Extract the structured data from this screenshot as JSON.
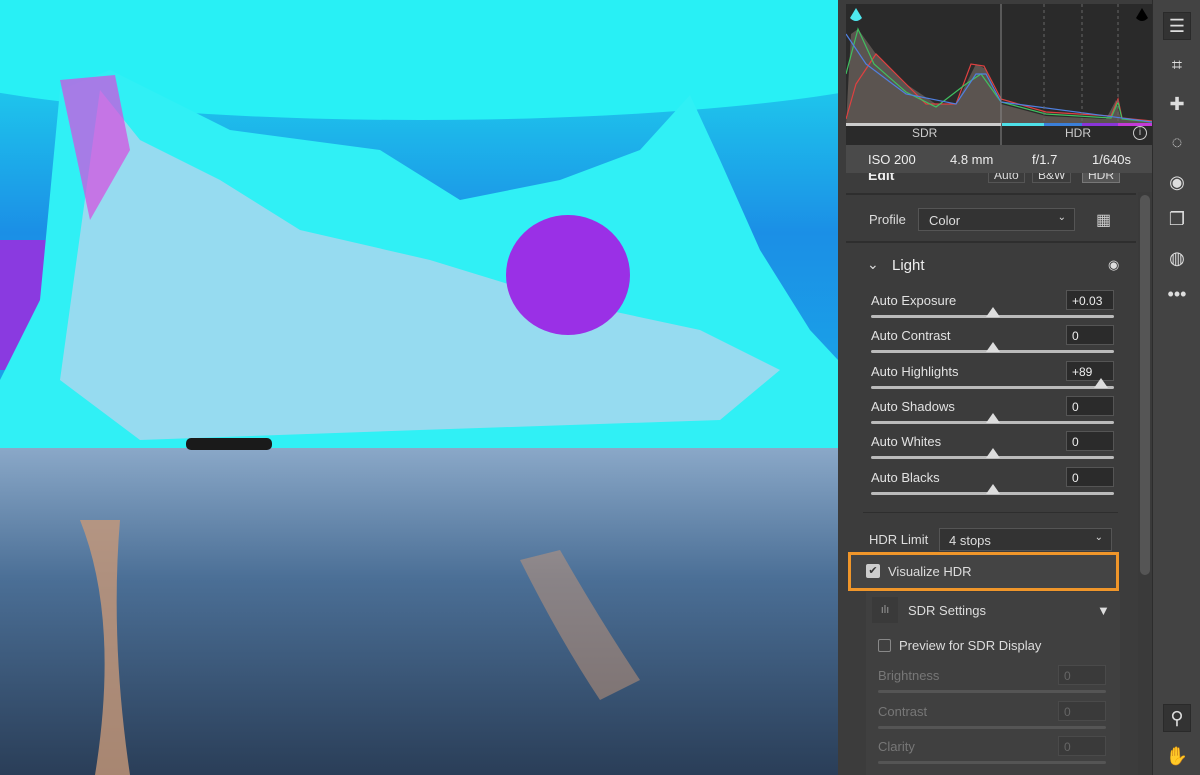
{
  "histogram": {
    "sdr_label": "SDR",
    "hdr_label": "HDR",
    "hdr_colors": [
      "#4ee0e8",
      "#3b7fd8",
      "#8a35d8",
      "#c33ad8"
    ]
  },
  "exif": {
    "iso": "ISO 200",
    "focal": "4.8 mm",
    "aperture": "f/1.7",
    "shutter": "1/640s"
  },
  "edit": {
    "title": "Edit",
    "buttons": [
      "Auto",
      "B&W",
      "HDR"
    ]
  },
  "profile": {
    "label": "Profile",
    "value": "Color"
  },
  "light": {
    "title": "Light",
    "sliders": [
      {
        "label": "Auto Exposure",
        "value": "+0.03",
        "pos": 0.5
      },
      {
        "label": "Auto Contrast",
        "value": "0",
        "pos": 0.5
      },
      {
        "label": "Auto Highlights",
        "value": "+89",
        "pos": 0.945
      },
      {
        "label": "Auto Shadows",
        "value": "0",
        "pos": 0.5
      },
      {
        "label": "Auto Whites",
        "value": "0",
        "pos": 0.5
      },
      {
        "label": "Auto Blacks",
        "value": "0",
        "pos": 0.5
      }
    ]
  },
  "hdr_limit": {
    "label": "HDR Limit",
    "value": "4 stops"
  },
  "visualize_hdr": {
    "label": "Visualize HDR",
    "checked": true,
    "highlight_color": "#f0962a"
  },
  "sdr_settings": {
    "title": "SDR Settings",
    "preview_label": "Preview for SDR Display",
    "preview_checked": false,
    "sliders": [
      {
        "label": "Brightness",
        "value": "0"
      },
      {
        "label": "Contrast",
        "value": "0"
      },
      {
        "label": "Clarity",
        "value": "0"
      }
    ]
  },
  "toolbar": [
    "edit-icon",
    "crop-icon",
    "healing-icon",
    "mask-icon",
    "red-eye-icon",
    "presets-icon",
    "snapshots-icon",
    "more-icon"
  ]
}
